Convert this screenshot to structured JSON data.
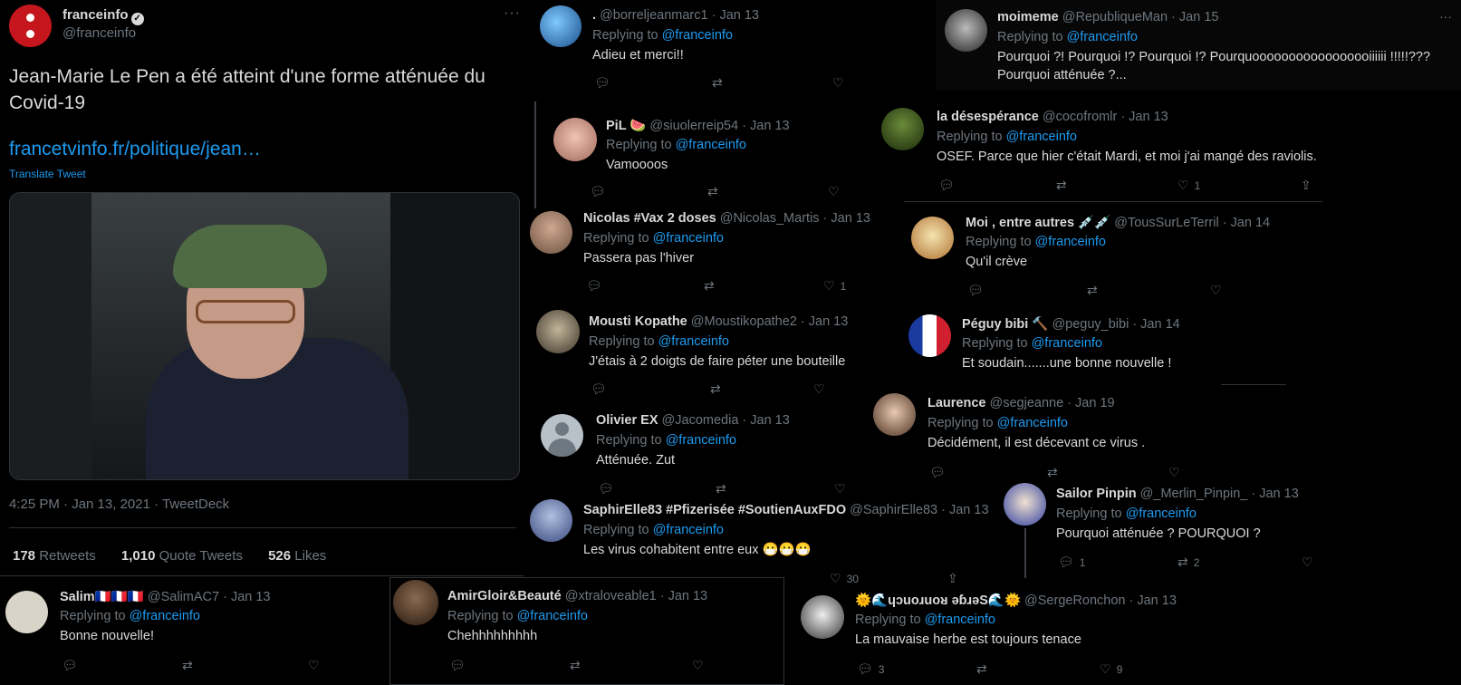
{
  "main_tweet": {
    "name": "franceinfo",
    "handle": "@franceinfo",
    "text": "Jean-Marie Le Pen a été atteint d'une forme atténuée du Covid-19",
    "link": "francetvinfo.fr/politique/jean…",
    "translate": "Translate Tweet",
    "timestamp": "4:25 PM · Jan 13, 2021 · TweetDeck",
    "retweets_count": "178",
    "retweets_label": "Retweets",
    "quotes_count": "1,010",
    "quotes_label": "Quote Tweets",
    "likes_count": "526",
    "likes_label": "Likes"
  },
  "replying_label": "Replying to",
  "replying_to": "@franceinfo",
  "icons": {
    "reply": "reply-icon",
    "retweet": "retweet-icon",
    "like": "like-icon",
    "share": "share-icon"
  },
  "replies": [
    {
      "name": ".",
      "meta": "@borreljeanmarc1 · Jan 13",
      "text": "Adieu et merci!!",
      "reply_count": "",
      "retweet_count": "",
      "like_count": ""
    },
    {
      "name": "PiL 🍉",
      "meta": "@siuolerreip54 · Jan 13",
      "text": "Vamoooos",
      "reply_count": "",
      "retweet_count": "",
      "like_count": ""
    },
    {
      "name": "Nicolas #Vax 2 doses",
      "meta": "@Nicolas_Martis · Jan 13",
      "text": "Passera pas l'hiver",
      "reply_count": "",
      "retweet_count": "",
      "like_count": "1"
    },
    {
      "name": "Mousti Kopathe",
      "meta": "@Moustikopathe2 · Jan 13",
      "text": "J'étais à 2 doigts de faire péter une bouteille",
      "reply_count": "",
      "retweet_count": "",
      "like_count": ""
    },
    {
      "name": "Olivier EX",
      "meta": "@Jacomedia · Jan 13",
      "text": "Atténuée. Zut",
      "reply_count": "",
      "retweet_count": "",
      "like_count": ""
    },
    {
      "name": "SaphirElle83 #Pfizerisée #SoutienAuxFDO",
      "meta": "@SaphirElle83 · Jan 13",
      "text": "Les virus cohabitent entre eux 😷😷😷",
      "reply_count": "",
      "retweet_count": "",
      "like_count": "30"
    },
    {
      "name": "Salim🇫🇷🇫🇷🇫🇷",
      "meta": "@SalimAC7 · Jan 13",
      "text": "Bonne  nouvelle!",
      "reply_count": "",
      "retweet_count": "",
      "like_count": ""
    },
    {
      "name": "AmirGloir&Beauté",
      "meta": "@xtraloveable1 · Jan 13",
      "text": "Chehhhhhhhhh",
      "reply_count": "",
      "retweet_count": "",
      "like_count": ""
    },
    {
      "name": "moimeme",
      "meta": "@RepubliqueMan · Jan 15",
      "text": "Pourquoi ?! Pourquoi !? Pourquoi !? Pourquooooooooooooooooiiiiii !!!!!???",
      "text2": "Pourquoi atténuée ?...",
      "reply_count": "",
      "retweet_count": "",
      "like_count": ""
    },
    {
      "name": "la désespérance",
      "meta": "@cocofromlr · Jan 13",
      "text": "OSEF. Parce que hier c'était Mardi, et moi j'ai mangé des raviolis.",
      "reply_count": "",
      "retweet_count": "",
      "like_count": "1"
    },
    {
      "name": "Moi , entre autres 💉💉",
      "meta": "@TousSurLeTerril · Jan 14",
      "text": "Qu'il crève",
      "reply_count": "",
      "retweet_count": "",
      "like_count": ""
    },
    {
      "name": "Péguy bibi 🔨",
      "meta": "@peguy_bibi · Jan 14",
      "text": "Et soudain.......une bonne nouvelle !",
      "reply_count": "",
      "retweet_count": "",
      "like_count": ""
    },
    {
      "name": "Laurence",
      "meta": "@segjeanne · Jan 19",
      "text": "Décidément, il est décevant ce virus .",
      "reply_count": "",
      "retweet_count": "",
      "like_count": ""
    },
    {
      "name": "Sailor Pinpin",
      "meta": "@_Merlin_Pinpin_ · Jan 13",
      "text": "Pourquoi atténuée ? POURQUOI ?",
      "reply_count": "1",
      "retweet_count": "2",
      "like_count": ""
    },
    {
      "name": "🌞🌊ɥɔuoɹuoᴚ ǝɓɹǝS🌊🌞",
      "meta": "@SergeRonchon · Jan 13",
      "text": "La mauvaise herbe est toujours tenace",
      "reply_count": "3",
      "retweet_count": "",
      "like_count": "9"
    }
  ]
}
